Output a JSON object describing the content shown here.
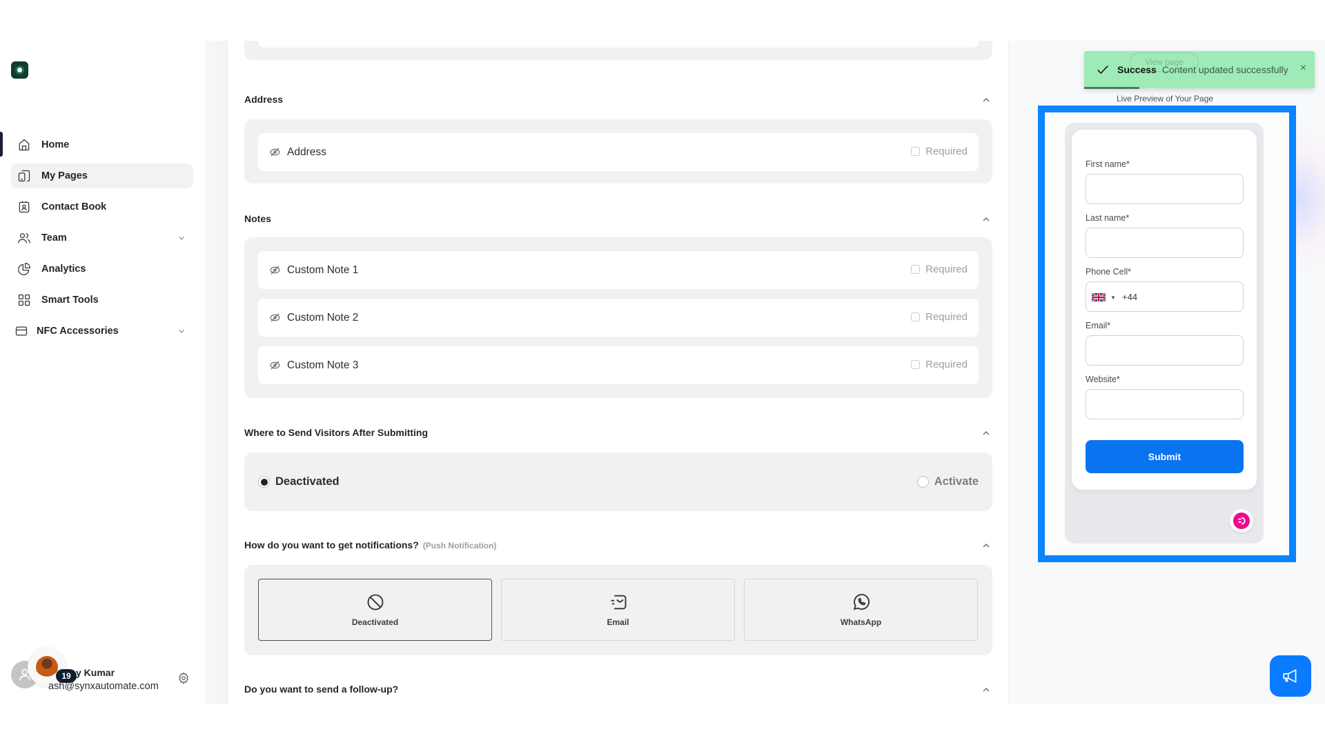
{
  "brand": {
    "logo_icon": "coffee-brand-logo"
  },
  "sidebar": {
    "items": [
      {
        "label": "Home",
        "icon": "home-icon",
        "active": false,
        "expandable": false
      },
      {
        "label": "My Pages",
        "icon": "pages-icon",
        "active": true,
        "expandable": false
      },
      {
        "label": "Contact Book",
        "icon": "contact-book-icon",
        "active": false,
        "expandable": false
      },
      {
        "label": "Team",
        "icon": "team-icon",
        "active": false,
        "expandable": true
      },
      {
        "label": "Analytics",
        "icon": "pie-chart-icon",
        "active": false,
        "expandable": false
      },
      {
        "label": "Smart Tools",
        "icon": "grid-icon",
        "active": false,
        "expandable": false
      },
      {
        "label": "NFC Accessories",
        "icon": "card-icon",
        "active": false,
        "expandable": true
      }
    ],
    "user": {
      "name_visible": "y Kumar",
      "email": "ash@synxautomate.com",
      "notification_count": "19"
    }
  },
  "main": {
    "sections": {
      "address": {
        "title": "Address",
        "fields": [
          {
            "label": "Address",
            "required_label": "Required",
            "required": false
          }
        ]
      },
      "notes": {
        "title": "Notes",
        "fields": [
          {
            "label": "Custom Note 1",
            "required_label": "Required",
            "required": false
          },
          {
            "label": "Custom Note 2",
            "required_label": "Required",
            "required": false
          },
          {
            "label": "Custom Note 3",
            "required_label": "Required",
            "required": false
          }
        ]
      },
      "redirect": {
        "title": "Where to Send Visitors After Submitting",
        "options": [
          {
            "label": "Deactivated",
            "selected": true
          },
          {
            "label": "Activate",
            "selected": false
          }
        ]
      },
      "notifications": {
        "title": "How do you want to get notifications?",
        "hint": "(Push Notification)",
        "options": [
          {
            "label": "Deactivated",
            "icon": "ban-icon",
            "selected": true
          },
          {
            "label": "Email",
            "icon": "email-icon",
            "selected": false
          },
          {
            "label": "WhatsApp",
            "icon": "whatsapp-icon",
            "selected": false
          }
        ]
      },
      "followup": {
        "title": "Do you want to send a follow-up?"
      }
    }
  },
  "preview": {
    "label": "Live Preview of Your Page",
    "highlight_color": "#0a84ff",
    "form": {
      "fields": [
        {
          "label": "First name*",
          "value": ""
        },
        {
          "label": "Last name*",
          "value": ""
        },
        {
          "label": "Phone Cell*",
          "country": "GB",
          "dial_code": "+44"
        },
        {
          "label": "Email*",
          "value": ""
        },
        {
          "label": "Website*",
          "value": ""
        }
      ],
      "submit_label": "Submit",
      "button_color": "#0a74f0"
    }
  },
  "toast": {
    "title": "Success",
    "message": "Content updated successfully",
    "behind_text": "View page",
    "close": "×",
    "color": "#9eebb8"
  },
  "feedback_button": {
    "icon": "megaphone-icon",
    "color": "#0a7bff"
  }
}
